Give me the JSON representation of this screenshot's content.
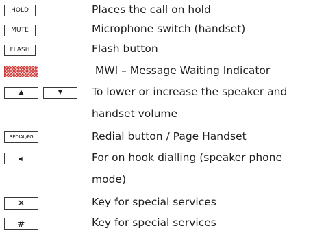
{
  "rows": [
    {
      "key": "HOLD",
      "desc": "Places the call on hold"
    },
    {
      "key": "MUTE",
      "desc": "Microphone switch (handset)"
    },
    {
      "key": "FLASH",
      "desc": "Flash button"
    },
    {
      "key": "",
      "desc": " MWI – Message Waiting Indicator"
    },
    {
      "key_up": "▲",
      "key_down": "▼",
      "desc_line1": "To lower or increase the speaker and",
      "desc_line2": "handset volume"
    },
    {
      "key": "REDIAL/PG",
      "desc": "Redial button / Page Handset"
    },
    {
      "key_icon": "speaker-icon",
      "desc_line1": "For on hook dialling (speaker phone",
      "desc_line2": "mode)"
    },
    {
      "key": "✕",
      "desc": "Key for special services"
    },
    {
      "key": "#",
      "desc": "Key for special services"
    }
  ],
  "colors": {
    "mwi_hatch": "#d23a3a"
  }
}
